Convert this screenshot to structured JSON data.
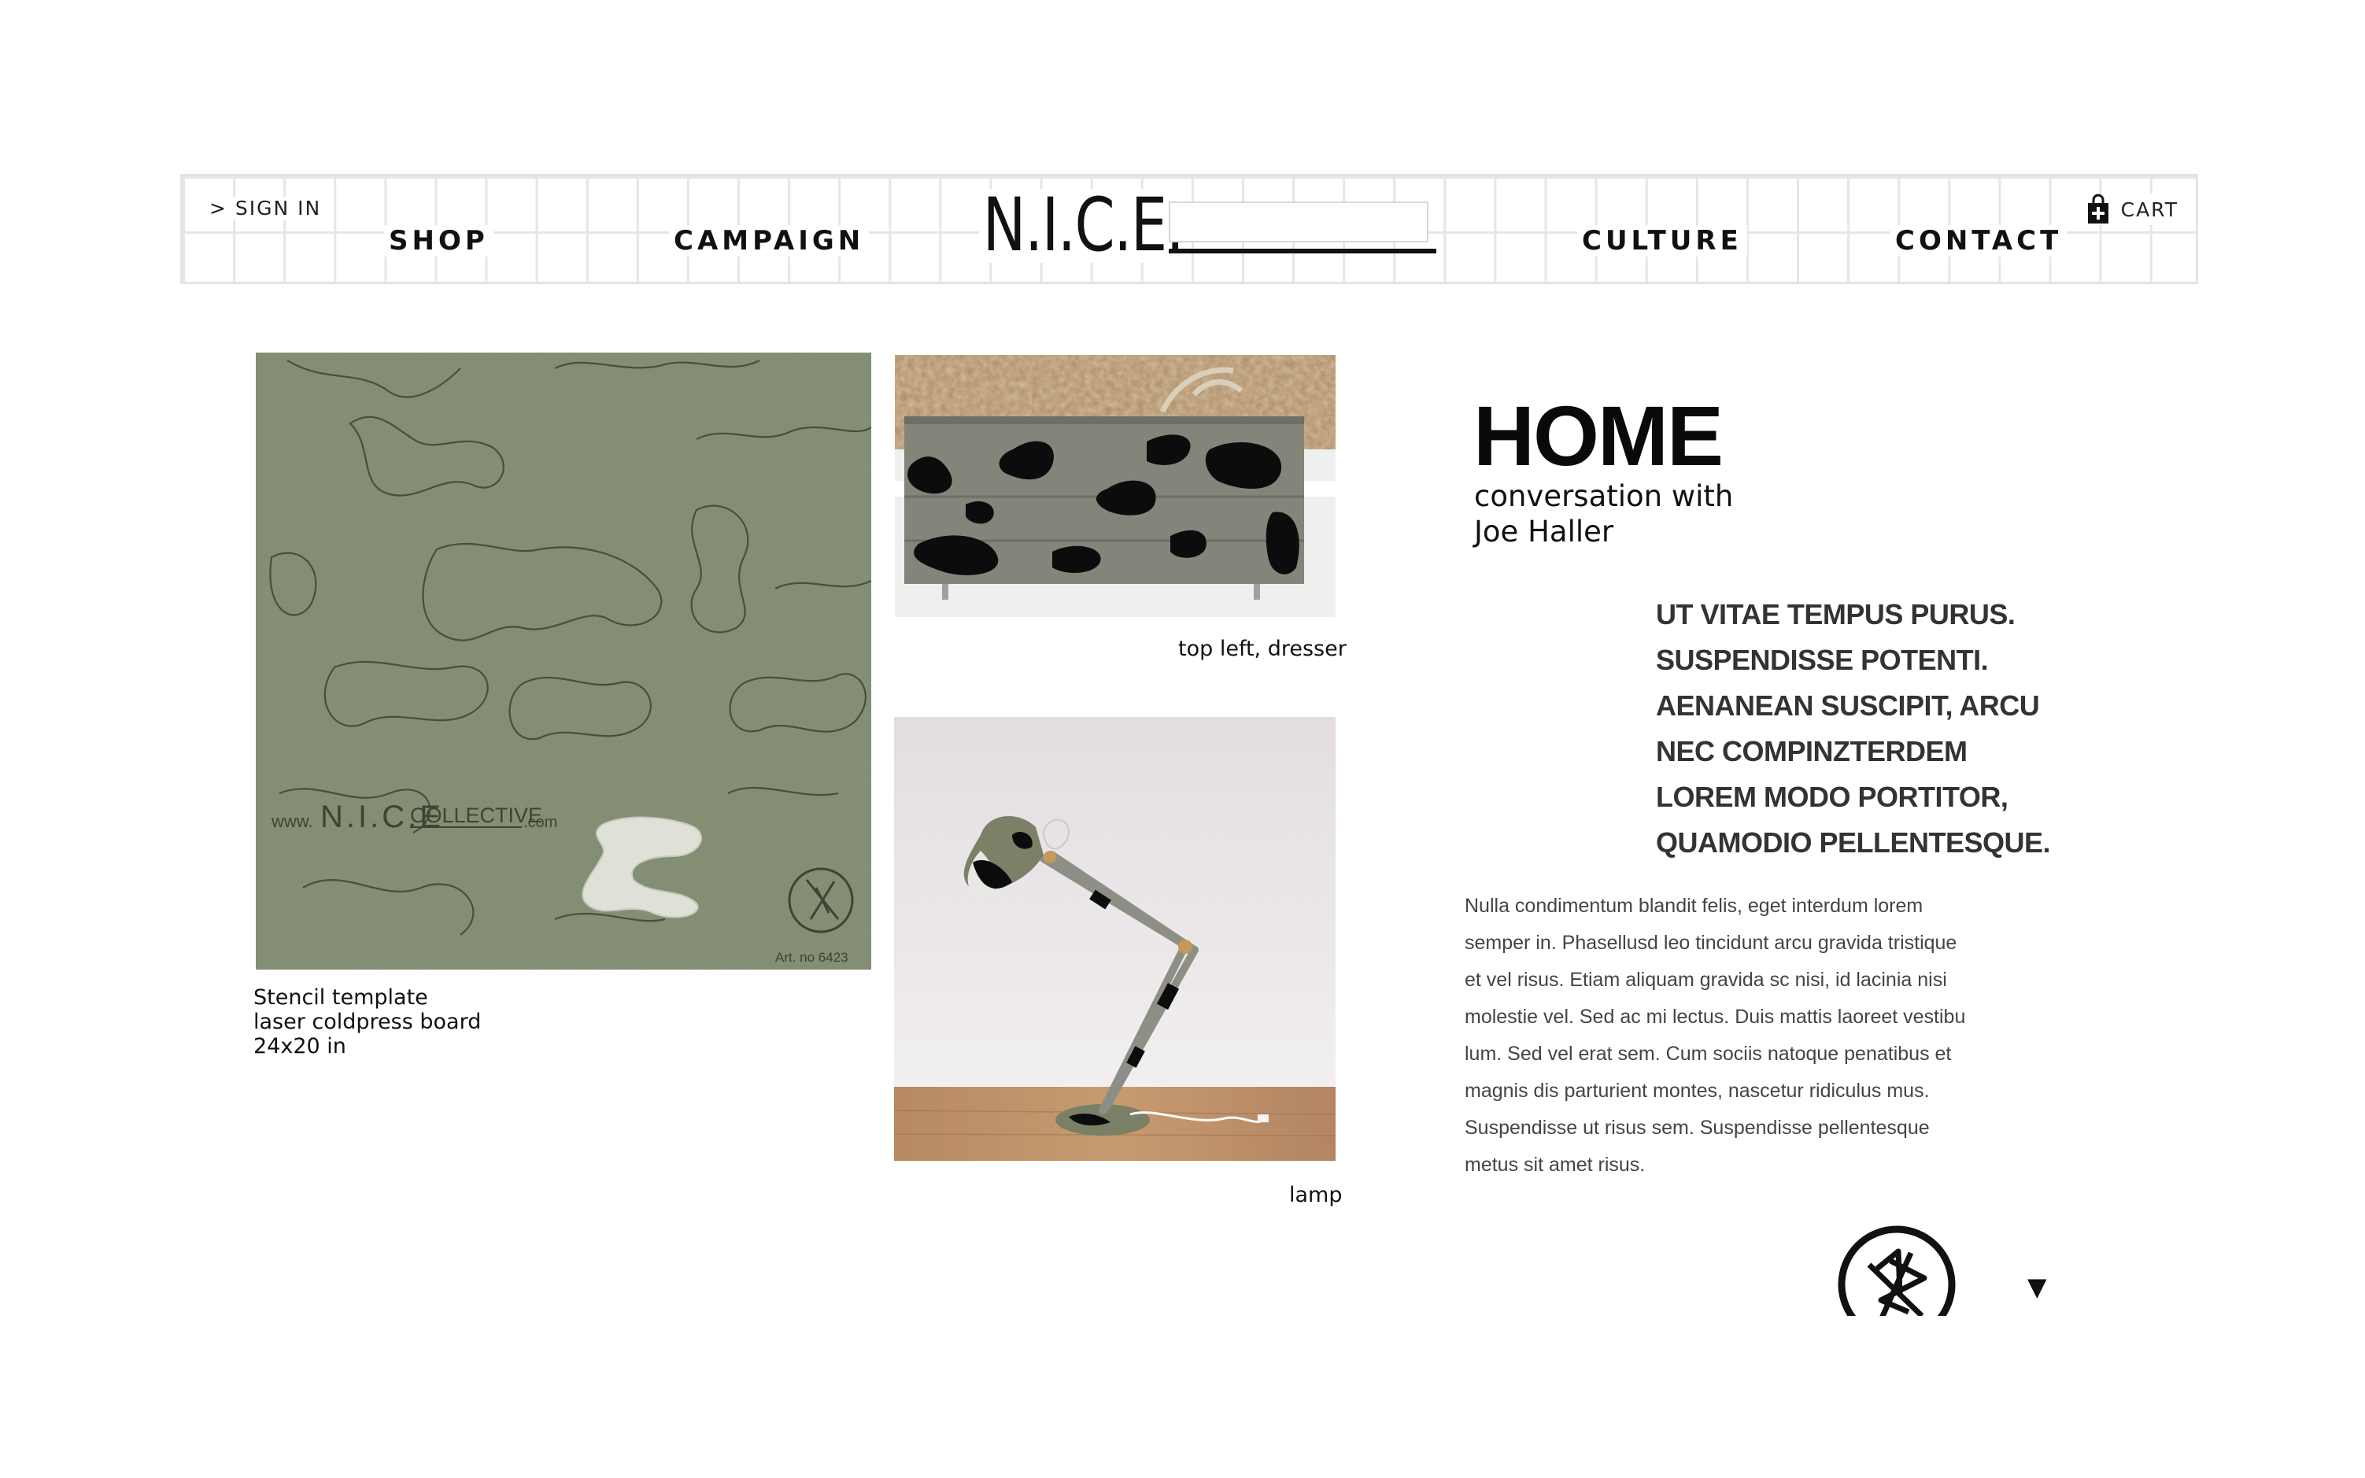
{
  "header": {
    "sign_in": "> SIGN IN",
    "cart": "CART",
    "logo": "N.I.C.E.",
    "nav": {
      "shop": "SHOP",
      "campaign": "CAMPAIGN",
      "culture": "CULTURE",
      "contact": "CONTACT"
    }
  },
  "images": {
    "stencil": {
      "brand_left": "www.",
      "brand_nice": "N.I.C.E",
      "brand_collective": "COLLECTIVE",
      "brand_com": ".com",
      "art_no": "Art. no 6423"
    }
  },
  "captions": {
    "stencil": [
      "Stencil template",
      "laser coldpress board",
      "24x20 in"
    ],
    "dresser": "top left, dresser",
    "lamp": "lamp"
  },
  "content": {
    "title": "HOME",
    "subtitle_line1": "conversation with",
    "subtitle_line2": "Joe Haller",
    "quote_lines": [
      "UT VITAE TEMPUS PURUS.",
      "SUSPENDISSE POTENTI.",
      "AENANEAN SUSCIPIT, ARCU",
      "NEC COMPINZTERDEM",
      "LOREM MODO PORTITOR,",
      "QUAMODIO PELLENTESQUE."
    ],
    "body_lines": [
      "Nulla condimentum blandit felis, eget interdum lorem",
      "semper in. Phasellusd leo tincidunt arcu gravida tristique",
      "et vel risus. Etiam aliquam gravida sc nisi, id lacinia nisi",
      "molestie vel. Sed ac mi lectus. Duis mattis laoreet vestibu",
      "lum. Sed vel erat sem. Cum sociis natoque penatibus et",
      "magnis dis parturient montes, nascetur ridiculus mus.",
      "Suspendisse ut risus sem. Suspendisse pellentesque",
      "metus sit amet risus."
    ]
  },
  "icons": {
    "cart": "shopping-bag-icon",
    "emblem": "nice-emblem-icon",
    "scroll": "down-arrow-icon"
  },
  "colors": {
    "olive": "#7f8a6e",
    "header_grid": "#e6e6e6",
    "text": "#111111"
  }
}
